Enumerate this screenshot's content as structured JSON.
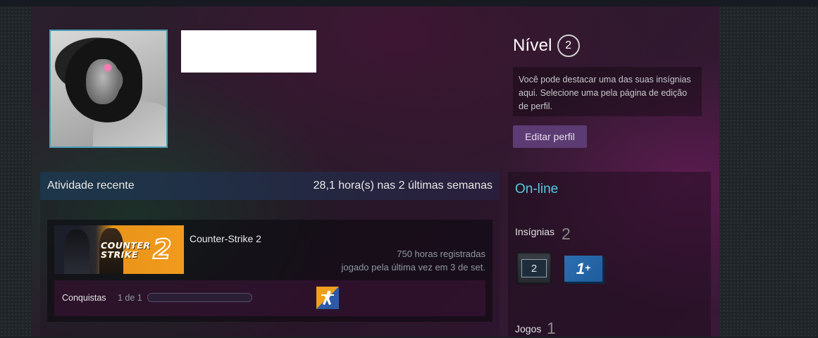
{
  "profile": {
    "level_label": "Nível",
    "level_value": "2",
    "badge_hint": "Você pode destacar uma das suas insígnias aqui. Selecione uma pela página de edição de perfil.",
    "edit_button": "Editar perfil",
    "status": "On-line"
  },
  "activity": {
    "title": "Atividade recente",
    "summary": "28,1 hora(s) nas 2 últimas semanas",
    "games": [
      {
        "name": "Counter-Strike 2",
        "capsule_text": "COUNTER STRIKE",
        "capsule_number": "2",
        "hours": "750 horas registradas",
        "last_played": "jogado pela última vez em 3 de set.",
        "achievements_label": "Conquistas",
        "achievements_count": "1 de 1",
        "achievements_progress": 0.0
      }
    ]
  },
  "sidebar": {
    "badges_title": "Insígnias",
    "badges_count": "2",
    "badge_level_text": "2",
    "badge_years_text": "1",
    "badge_years_sup": "+",
    "games_title": "Jogos",
    "games_count": "1"
  },
  "colors": {
    "status_online": "#57cbde",
    "avatar_border": "#4c9fb7",
    "edit_button_bg": "#5c3b73"
  }
}
